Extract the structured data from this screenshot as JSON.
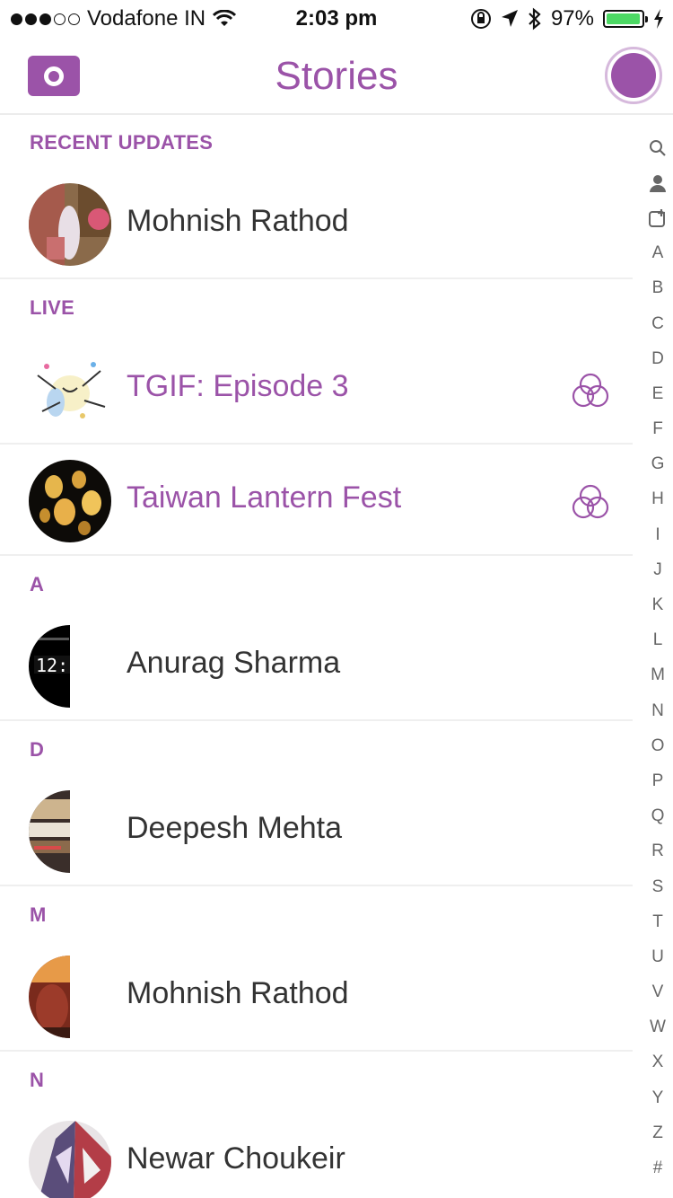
{
  "status": {
    "carrier": "Vodafone IN",
    "time": "2:03 pm",
    "battery": "97%",
    "battery_level": 0.97,
    "signal_bars": 3
  },
  "header": {
    "title": "Stories"
  },
  "sections": {
    "recent": "RECENT UPDATES",
    "live": "LIVE",
    "a": "A",
    "d": "D",
    "m": "M",
    "n": "N"
  },
  "rows": {
    "recent_1": "Mohnish Rathod",
    "live_1": "TGIF: Episode 3",
    "live_2": "Taiwan Lantern Fest",
    "a_1": "Anurag Sharma",
    "d_1": "Deepesh Mehta",
    "m_1": "Mohnish Rathod",
    "n_1": "Newar Choukeir"
  },
  "index": [
    "Q",
    "person",
    "add",
    "A",
    "B",
    "C",
    "D",
    "E",
    "F",
    "G",
    "H",
    "I",
    "J",
    "K",
    "L",
    "M",
    "N",
    "O",
    "P",
    "Q",
    "R",
    "S",
    "T",
    "U",
    "V",
    "W",
    "X",
    "Y",
    "Z",
    "#"
  ],
  "colors": {
    "accent": "#9b53a8"
  }
}
